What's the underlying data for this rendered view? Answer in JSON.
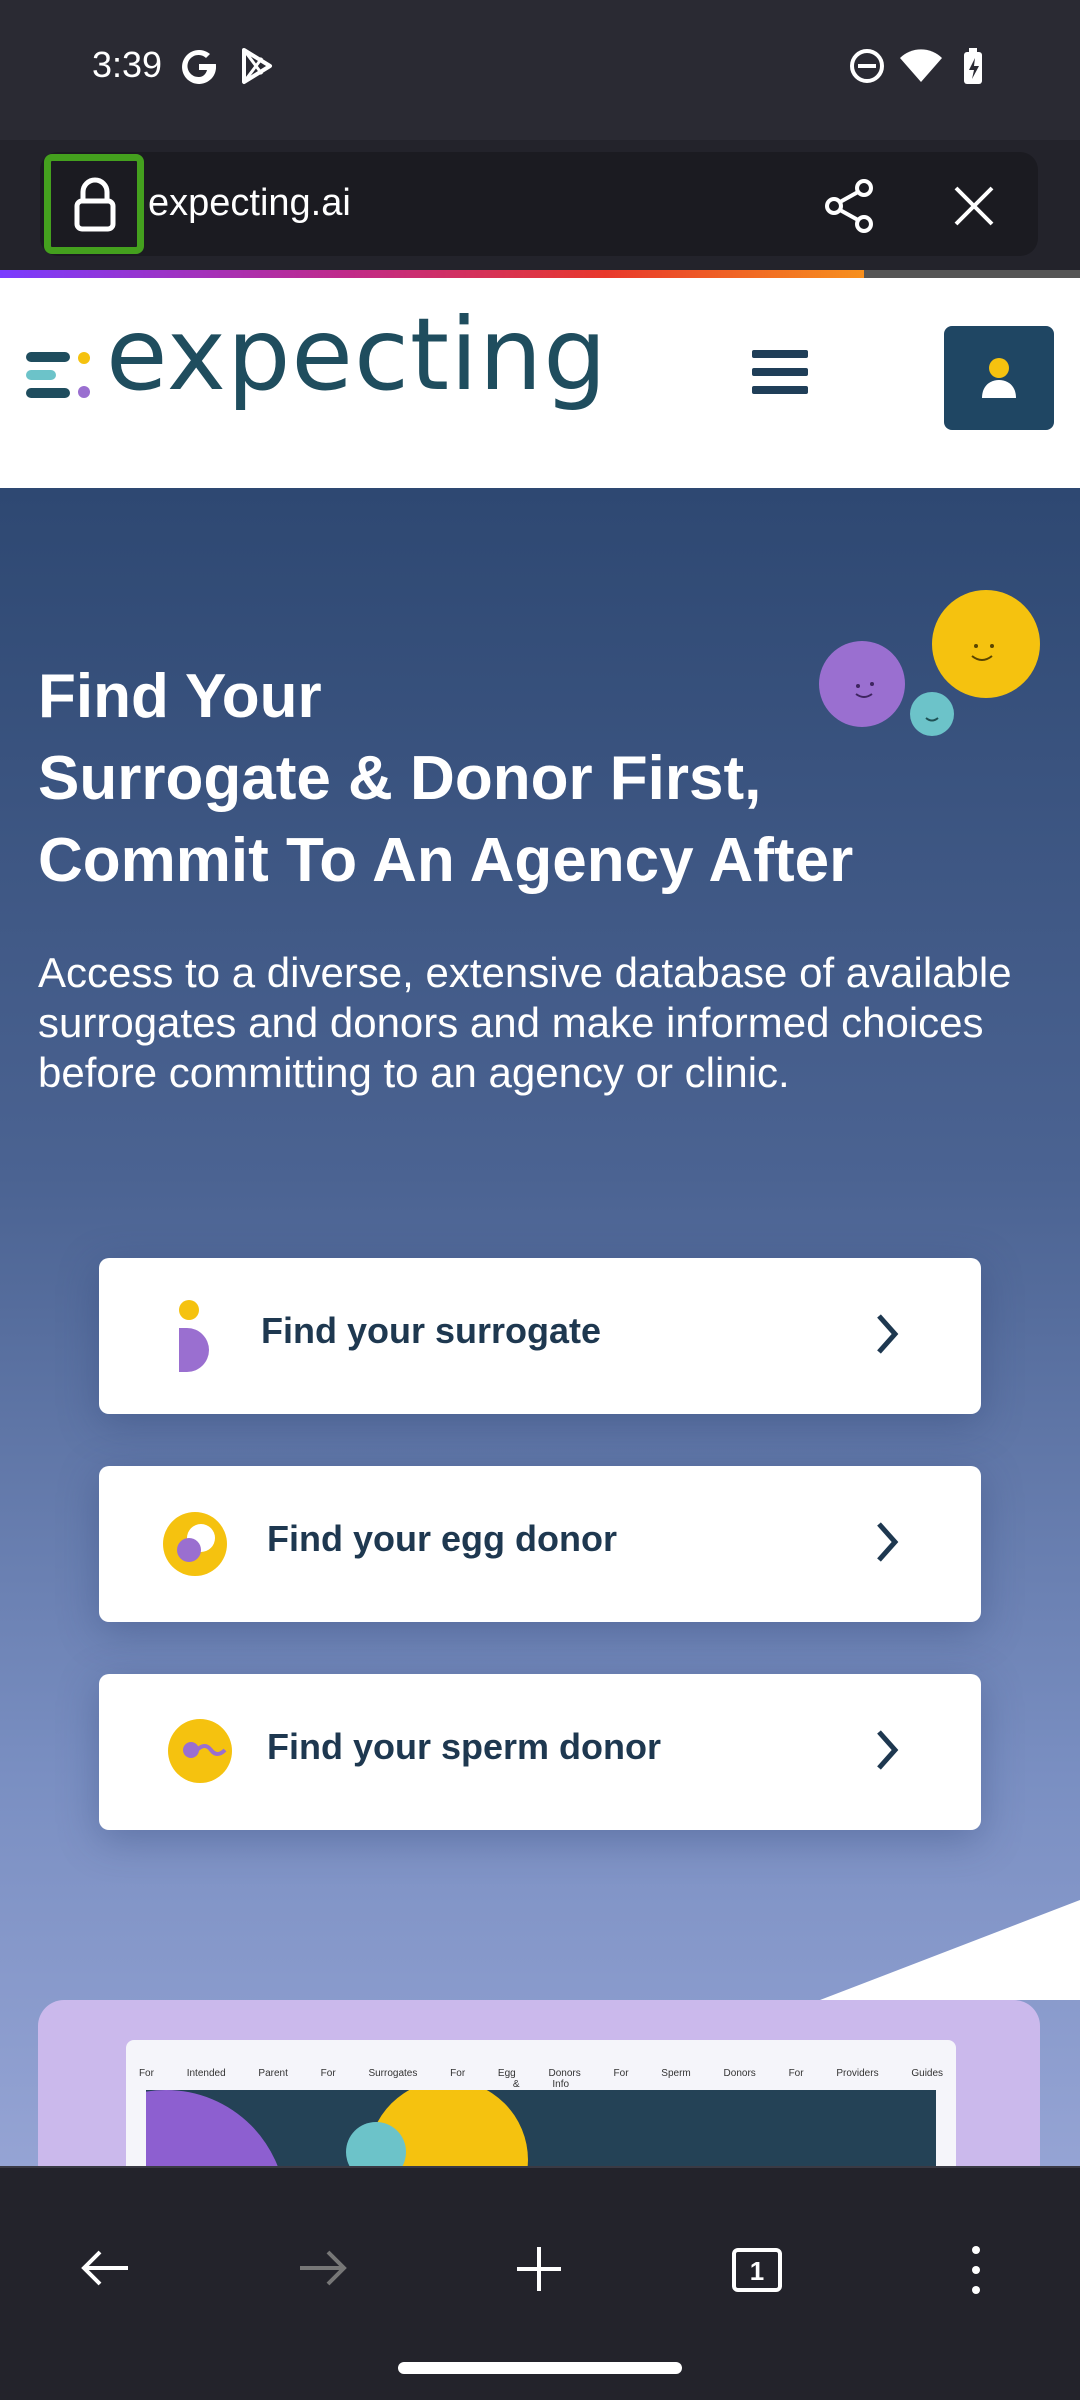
{
  "status_bar": {
    "time": "3:39",
    "icons": [
      "google-icon",
      "play-store-icon",
      "do-not-disturb-icon",
      "wifi-icon",
      "battery-charging-icon"
    ]
  },
  "browser": {
    "url": "expecting.ai",
    "lock_icon": "lock-icon",
    "share_icon": "share-icon",
    "close_icon": "close-icon",
    "progress_percent": 80
  },
  "site": {
    "logo_text": "expecting",
    "menu_icon": "hamburger-menu-icon",
    "account_icon": "user-icon"
  },
  "hero": {
    "title_lines": [
      "Find Your",
      "Surrogate & Donor First,",
      "Commit To An Agency After"
    ],
    "subtitle": "Access to a diverse, extensive database of available surrogates and donors and make informed choices before committing to an agency or clinic."
  },
  "cards": [
    {
      "label": "Find your surrogate",
      "icon": "surrogate-icon"
    },
    {
      "label": "Find your egg donor",
      "icon": "egg-donor-icon"
    },
    {
      "label": "Find your sperm donor",
      "icon": "sperm-donor-icon"
    }
  ],
  "preview": {
    "nav_items": [
      "For Intended Parent",
      "For Surrogates",
      "For Egg Donors",
      "For Sperm Donors",
      "For Providers",
      "Guides & Info"
    ]
  },
  "bottom_nav": {
    "tab_count": "1",
    "icons": [
      "back-arrow-icon",
      "forward-arrow-icon",
      "new-tab-icon",
      "tab-switcher-icon",
      "more-options-icon"
    ]
  },
  "colors": {
    "brand_dark": "#1f4d5e",
    "yellow": "#f5c20f",
    "purple": "#9a6fd0",
    "teal": "#6cc3c9",
    "highlight": "#44a01e"
  }
}
